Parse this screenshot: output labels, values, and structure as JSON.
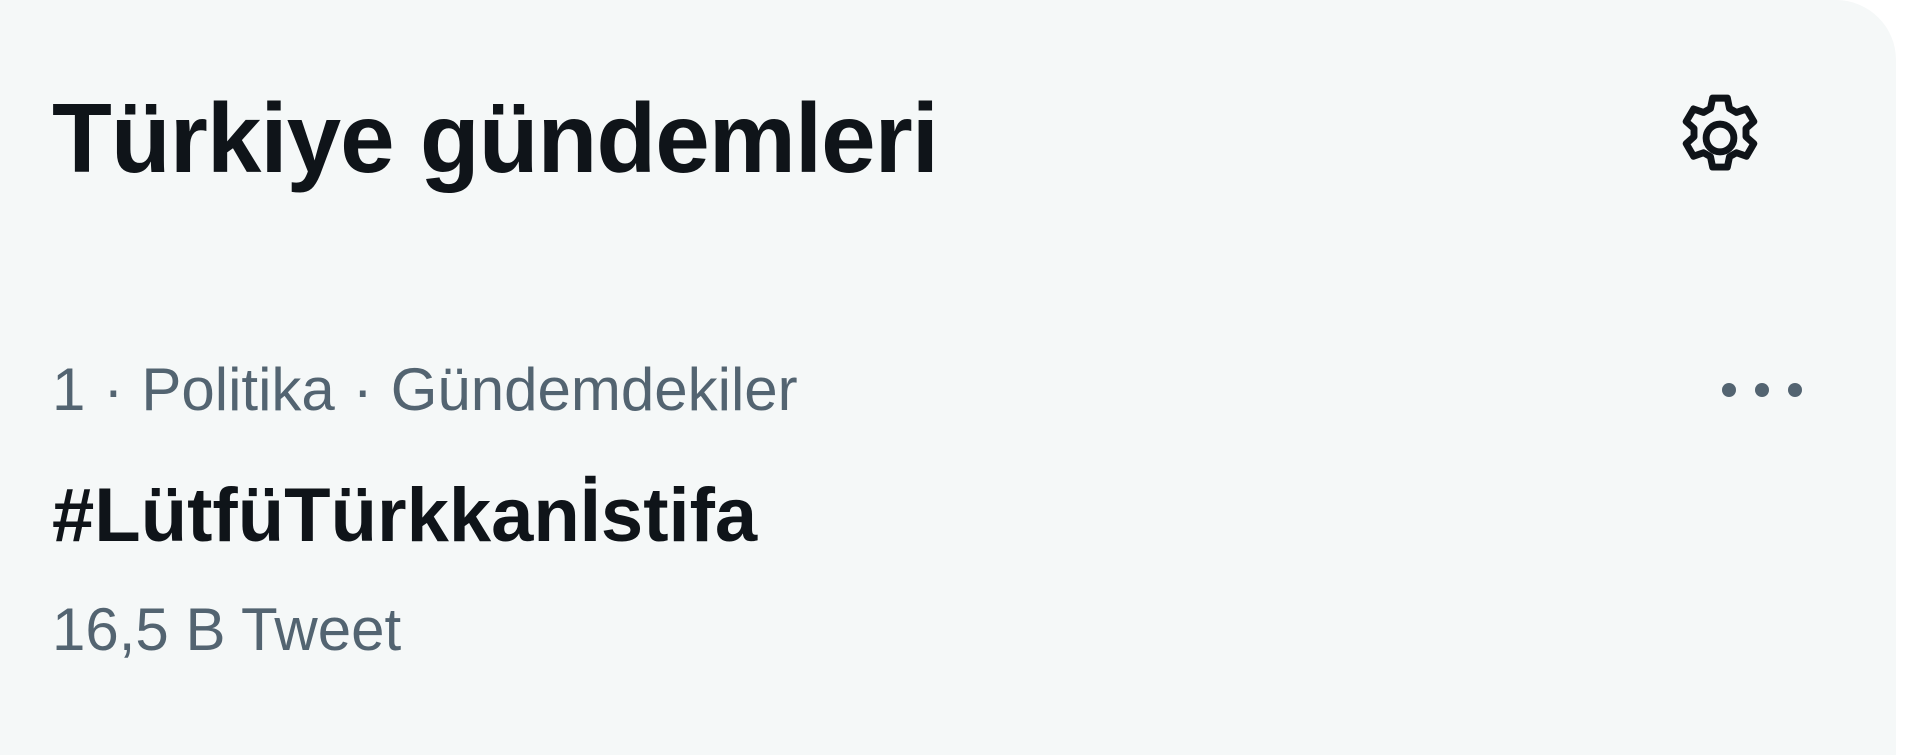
{
  "header": {
    "title": "Türkiye gündemleri",
    "settings_icon": "gear-icon"
  },
  "trends": [
    {
      "rank": "1",
      "separator": "·",
      "category": "Politika",
      "context": "Gündemdekiler",
      "name": "#LütfüTürkkanİstifa",
      "tweet_count": "16,5 B Tweet",
      "more_icon": "more-horizontal-icon"
    }
  ],
  "colors": {
    "background": "#f5f8f8",
    "primary_text": "#0f1419",
    "secondary_text": "#536471"
  }
}
